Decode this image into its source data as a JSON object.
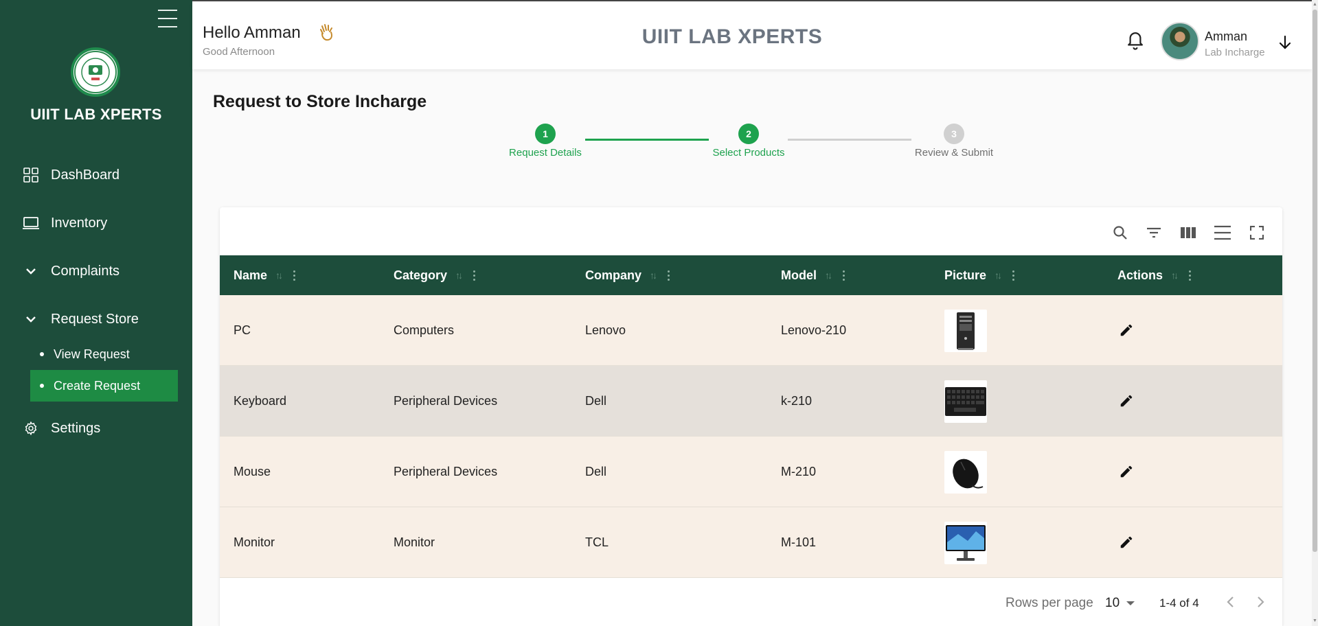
{
  "sidebar": {
    "brand": "UIIT LAB XPERTS",
    "items": [
      {
        "label": "DashBoard",
        "icon": "dashboard-grid-icon"
      },
      {
        "label": "Inventory",
        "icon": "laptop-icon"
      },
      {
        "label": "Complaints",
        "icon": "chevron-down-icon"
      },
      {
        "label": "Request Store",
        "icon": "chevron-down-icon"
      },
      {
        "label": "Settings",
        "icon": "gear-icon"
      }
    ],
    "sub_items": [
      {
        "label": "View Request",
        "active": false
      },
      {
        "label": "Create Request",
        "active": true
      }
    ],
    "colors": {
      "background": "#1d4d3b",
      "active": "#1e8b44"
    }
  },
  "header": {
    "greeting": "Hello Amman",
    "sub_greeting": "Good Afternoon",
    "app_title": "UIIT LAB XPERTS",
    "user_name": "Amman",
    "user_role": "Lab Incharge"
  },
  "page": {
    "title": "Request to Store Incharge",
    "steps": [
      {
        "number": "1",
        "label": "Request Details",
        "state": "complete"
      },
      {
        "number": "2",
        "label": "Select Products",
        "state": "active"
      },
      {
        "number": "3",
        "label": "Review & Submit",
        "state": "pending"
      }
    ],
    "step_colors": {
      "done": "#1ea24e",
      "pending": "#d0d0d0"
    }
  },
  "table": {
    "columns": [
      "Name",
      "Category",
      "Company",
      "Model",
      "Picture",
      "Actions"
    ],
    "rows": [
      {
        "name": "PC",
        "category": "Computers",
        "company": "Lenovo",
        "model": "Lenovo-210",
        "picture": "pc-tower-image"
      },
      {
        "name": "Keyboard",
        "category": "Peripheral Devices",
        "company": "Dell",
        "model": "k-210",
        "picture": "keyboard-image"
      },
      {
        "name": "Mouse",
        "category": "Peripheral Devices",
        "company": "Dell",
        "model": "M-210",
        "picture": "mouse-image"
      },
      {
        "name": "Monitor",
        "category": "Monitor",
        "company": "TCL",
        "model": "M-101",
        "picture": "monitor-image"
      }
    ],
    "row_colors": [
      "#f8efe6",
      "#e5e0da",
      "#f8efe6",
      "#f8efe6"
    ],
    "toolbar_icons": [
      "search-icon",
      "filter-icon",
      "columns-icon",
      "density-icon",
      "fullscreen-icon"
    ],
    "footer": {
      "rows_per_page_label": "Rows per page",
      "rows_per_page": "10",
      "range": "1-4 of 4"
    }
  }
}
